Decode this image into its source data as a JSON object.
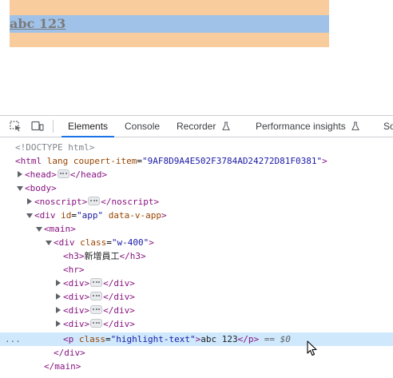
{
  "preview": {
    "text": "abc 123"
  },
  "devtools": {
    "tabs": [
      {
        "label": "Elements",
        "active": true
      },
      {
        "label": "Console"
      },
      {
        "label": "Recorder",
        "flask": true
      },
      {
        "label": "Performance insights",
        "flask": true
      },
      {
        "label": "So"
      }
    ],
    "tree": {
      "doctype": "<!DOCTYPE html>",
      "html_open": "<html",
      "html_attr_lang": "lang",
      "html_attr_coupert": "coupert-item",
      "html_attr_coupert_val": "\"9AF8D9A4E502F3784AD24272D81F0381\"",
      "html_close": ">",
      "head_open": "<head>",
      "head_close": "</head>",
      "body_open": "<body>",
      "noscript_open": "<noscript>",
      "noscript_close": "</noscript>",
      "div_app_open": "<div",
      "div_app_id_name": "id",
      "div_app_id_val": "\"app\"",
      "div_app_vapp": "data-v-app",
      "div_app_end": ">",
      "main_open": "<main>",
      "div_w_open": "<div",
      "div_w_class_name": "class",
      "div_w_class_val": "\"w-400\"",
      "div_w_end": ">",
      "h3_open": "<h3>",
      "h3_text": "新增員工",
      "h3_close": "</h3>",
      "hr": "<hr>",
      "div_open": "<div>",
      "div_close": "</div>",
      "p_open": "<p",
      "p_class_name": "class",
      "p_class_val": "\"highlight-text\"",
      "p_end": ">",
      "p_text": "abc 123",
      "p_close": "</p>",
      "selected_marker": "== $0",
      "div_w_close": "</div>",
      "main_close": "</main>",
      "row_dots": "..."
    }
  }
}
